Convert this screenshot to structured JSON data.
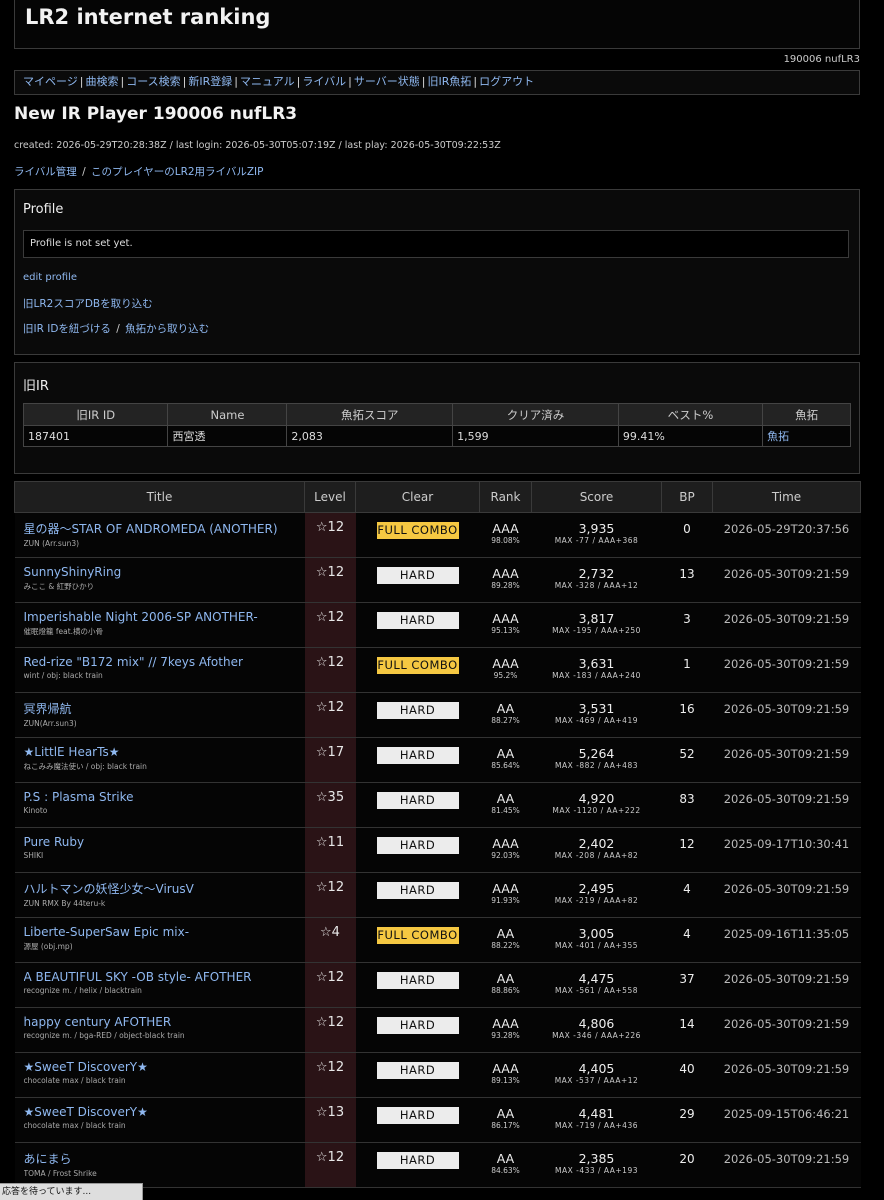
{
  "site_title": "LR2 internet ranking",
  "user_line": "190006 nufLR3",
  "nav": [
    "マイページ",
    "曲検索",
    "コース検索",
    "新IR登録",
    "マニュアル",
    "ライバル",
    "サーバー状態",
    "旧IR魚拓",
    "ログアウト"
  ],
  "nav_sep": "|",
  "player_title": "New IR Player 190006 nufLR3",
  "meta": "created: 2026-05-29T20:28:38Z / last login: 2026-05-30T05:07:19Z / last play: 2026-05-30T09:22:53Z",
  "rival_links": {
    "manage": "ライバル管理",
    "sep": "/",
    "zip": "このプレイヤーのLR2用ライバルZIP"
  },
  "profile": {
    "heading": "Profile",
    "text": "Profile is not set yet.",
    "edit": "edit profile",
    "import_db": "旧LR2スコアDBを取り込む",
    "link_id": "旧IR IDを紐づける",
    "sep": "/",
    "import_gyotaku": "魚拓から取り込む"
  },
  "old_ir": {
    "heading": "旧IR",
    "headers": [
      "旧IR ID",
      "Name",
      "魚拓スコア",
      "クリア済み",
      "ベスト%",
      "魚拓"
    ],
    "row": [
      "187401",
      "西宮透",
      "2,083",
      "1,599",
      "99.41%",
      "魚拓"
    ]
  },
  "score_headers": [
    "Title",
    "Level",
    "Clear",
    "Rank",
    "Score",
    "BP",
    "Time"
  ],
  "scores": [
    {
      "title": "星の器～STAR OF ANDROMEDA (ANOTHER)",
      "artist": "ZUN (Arr.sun3)",
      "level": "☆12",
      "clear": "FULL COMBO",
      "rank": "AAA",
      "pct": "98.08%",
      "score": "3,935",
      "diff": "MAX -77 / AAA+368",
      "bp": "0",
      "time": "2026-05-29T20:37:56"
    },
    {
      "title": "SunnyShinyRing",
      "artist": "みここ & 紅野ひかり",
      "level": "☆12",
      "clear": "HARD",
      "rank": "AAA",
      "pct": "89.28%",
      "score": "2,732",
      "diff": "MAX -328 / AAA+12",
      "bp": "13",
      "time": "2026-05-30T09:21:59"
    },
    {
      "title": "Imperishable Night 2006-SP ANOTHER-",
      "artist": "催眠燈籠 feat.横の小骨",
      "level": "☆12",
      "clear": "HARD",
      "rank": "AAA",
      "pct": "95.13%",
      "score": "3,817",
      "diff": "MAX -195 / AAA+250",
      "bp": "3",
      "time": "2026-05-30T09:21:59"
    },
    {
      "title": "Red-rize \"B172 mix\" // 7keys Afother",
      "artist": "wint / obj: black train",
      "level": "☆12",
      "clear": "FULL COMBO",
      "rank": "AAA",
      "pct": "95.2%",
      "score": "3,631",
      "diff": "MAX -183 / AAA+240",
      "bp": "1",
      "time": "2026-05-30T09:21:59"
    },
    {
      "title": "冥界帰航",
      "artist": "ZUN(Arr.sun3)",
      "level": "☆12",
      "clear": "HARD",
      "rank": "AA",
      "pct": "88.27%",
      "score": "3,531",
      "diff": "MAX -469 / AA+419",
      "bp": "16",
      "time": "2026-05-30T09:21:59"
    },
    {
      "title": "★LittlE HearTs★",
      "artist": "ねこみみ魔法使い / obj: black train",
      "level": "☆17",
      "clear": "HARD",
      "rank": "AA",
      "pct": "85.64%",
      "score": "5,264",
      "diff": "MAX -882 / AA+483",
      "bp": "52",
      "time": "2026-05-30T09:21:59"
    },
    {
      "title": "P.S : Plasma Strike",
      "artist": "Kinoto",
      "level": "☆35",
      "clear": "HARD",
      "rank": "AA",
      "pct": "81.45%",
      "score": "4,920",
      "diff": "MAX -1120 / AA+222",
      "bp": "83",
      "time": "2026-05-30T09:21:59"
    },
    {
      "title": "Pure Ruby",
      "artist": "SHIKI",
      "level": "☆11",
      "clear": "HARD",
      "rank": "AAA",
      "pct": "92.03%",
      "score": "2,402",
      "diff": "MAX -208 / AAA+82",
      "bp": "12",
      "time": "2025-09-17T10:30:41"
    },
    {
      "title": "ハルトマンの妖怪少女～VirusV",
      "artist": "ZUN RMX By 44teru-k",
      "level": "☆12",
      "clear": "HARD",
      "rank": "AAA",
      "pct": "91.93%",
      "score": "2,495",
      "diff": "MAX -219 / AAA+82",
      "bp": "4",
      "time": "2026-05-30T09:21:59"
    },
    {
      "title": "Liberte-SuperSaw Epic mix-",
      "artist": "源屋 (obj.mp)",
      "level": "☆4",
      "clear": "FULL COMBO",
      "rank": "AA",
      "pct": "88.22%",
      "score": "3,005",
      "diff": "MAX -401 / AA+355",
      "bp": "4",
      "time": "2025-09-16T11:35:05"
    },
    {
      "title": "A BEAUTIFUL SKY -OB style- AFOTHER",
      "artist": "recognize m. / helix / blacktrain",
      "level": "☆12",
      "clear": "HARD",
      "rank": "AA",
      "pct": "88.86%",
      "score": "4,475",
      "diff": "MAX -561 / AA+558",
      "bp": "37",
      "time": "2026-05-30T09:21:59"
    },
    {
      "title": "happy century AFOTHER",
      "artist": "recognize m. / bga-RED / object-black train",
      "level": "☆12",
      "clear": "HARD",
      "rank": "AAA",
      "pct": "93.28%",
      "score": "4,806",
      "diff": "MAX -346 / AAA+226",
      "bp": "14",
      "time": "2026-05-30T09:21:59"
    },
    {
      "title": "★SweeT DiscoverY★",
      "artist": "chocolate max / black train",
      "level": "☆12",
      "clear": "HARD",
      "rank": "AAA",
      "pct": "89.13%",
      "score": "4,405",
      "diff": "MAX -537 / AAA+12",
      "bp": "40",
      "time": "2026-05-30T09:21:59"
    },
    {
      "title": "★SweeT DiscoverY★",
      "artist": "chocolate max / black train",
      "level": "☆13",
      "clear": "HARD",
      "rank": "AA",
      "pct": "86.17%",
      "score": "4,481",
      "diff": "MAX -719 / AA+436",
      "bp": "29",
      "time": "2025-09-15T06:46:21"
    },
    {
      "title": "あにまら",
      "artist": "TOMA / Frost Shrike",
      "level": "☆12",
      "clear": "HARD",
      "rank": "AA",
      "pct": "84.63%",
      "score": "2,385",
      "diff": "MAX -433 / AA+193",
      "bp": "20",
      "time": "2026-05-30T09:21:59"
    }
  ],
  "status_bar": "応答を待っています..."
}
